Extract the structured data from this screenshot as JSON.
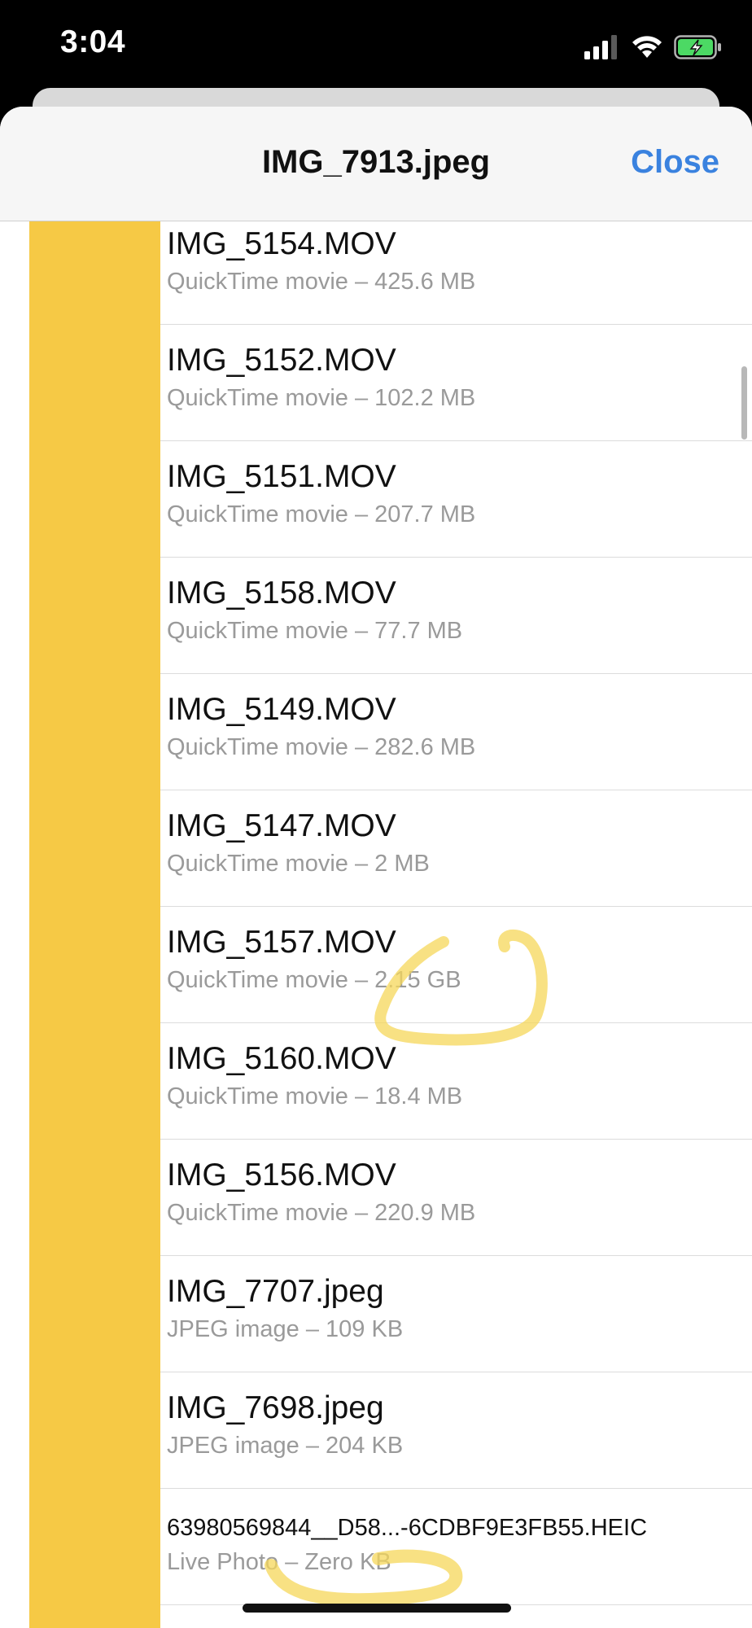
{
  "status_bar": {
    "time": "3:04",
    "signal_icon": "cellular-signal-icon",
    "wifi_icon": "wifi-icon",
    "battery_icon": "battery-charging-icon",
    "battery_color": "#4cd964"
  },
  "header": {
    "title": "IMG_7913.jpeg",
    "close_label": "Close",
    "accent_color": "#3a82df"
  },
  "files": [
    {
      "name": "IMG_5154.MOV",
      "meta": "QuickTime movie – 425.6 MB"
    },
    {
      "name": "IMG_5152.MOV",
      "meta": "QuickTime movie – 102.2 MB"
    },
    {
      "name": "IMG_5151.MOV",
      "meta": "QuickTime movie – 207.7 MB"
    },
    {
      "name": "IMG_5158.MOV",
      "meta": "QuickTime movie – 77.7 MB"
    },
    {
      "name": "IMG_5149.MOV",
      "meta": "QuickTime movie – 282.6 MB"
    },
    {
      "name": "IMG_5147.MOV",
      "meta": "QuickTime movie – 2 MB"
    },
    {
      "name": "IMG_5157.MOV",
      "meta": "QuickTime movie – 2.15 GB"
    },
    {
      "name": "IMG_5160.MOV",
      "meta": "QuickTime movie – 18.4 MB"
    },
    {
      "name": "IMG_5156.MOV",
      "meta": "QuickTime movie – 220.9 MB"
    },
    {
      "name": "IMG_7707.jpeg",
      "meta": "JPEG image – 109 KB"
    },
    {
      "name": "IMG_7698.jpeg",
      "meta": "JPEG image – 204 KB"
    },
    {
      "name": "63980569844__D58...-6CDBF9E3FB55.HEIC",
      "meta": "Live Photo – Zero KB"
    }
  ],
  "colors": {
    "thumbnail_block": "#f6c945",
    "annotation_stroke": "#f5d75a"
  }
}
